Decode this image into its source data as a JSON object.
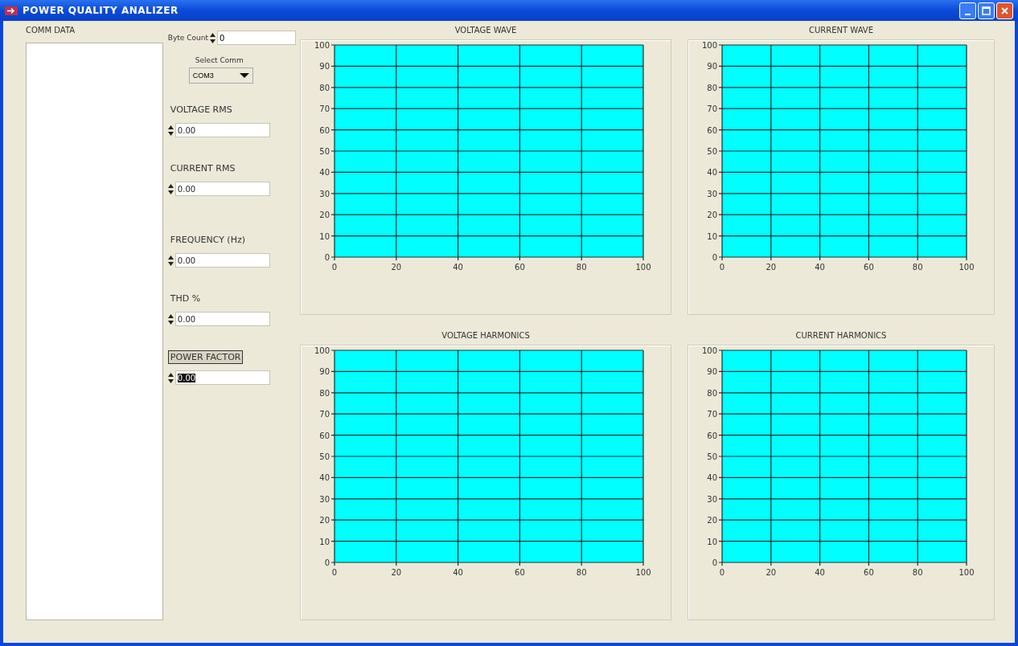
{
  "window": {
    "title": "POWER QUALITY ANALIZER"
  },
  "comm_data": {
    "label": "COMM DATA"
  },
  "byte_count": {
    "label": "Byte Count",
    "value": "0"
  },
  "select_comm": {
    "label": "Select Comm",
    "value": "COM3"
  },
  "readings": [
    {
      "label": "VOLTAGE RMS",
      "value": "0.00",
      "focused": false,
      "text_selected": false
    },
    {
      "label": "CURRENT RMS",
      "value": "0.00",
      "focused": false,
      "text_selected": false
    },
    {
      "label": "FREQUENCY (Hz)",
      "value": "0.00",
      "focused": false,
      "text_selected": false
    },
    {
      "label": "THD %",
      "value": "0.00",
      "focused": false,
      "text_selected": false
    },
    {
      "label": "POWER FACTOR",
      "value": "0.00",
      "focused": true,
      "text_selected": true
    }
  ],
  "charts": [
    {
      "chart_data": {
        "type": "line",
        "grid": true,
        "title": "VOLTAGE WAVE",
        "xlim": [
          0,
          100
        ],
        "ylim": [
          0,
          100
        ],
        "xticks": [
          0,
          20,
          40,
          60,
          80,
          100
        ],
        "yticks": [
          0,
          10,
          20,
          30,
          40,
          50,
          60,
          70,
          80,
          90,
          100
        ]
      }
    },
    {
      "chart_data": {
        "type": "line",
        "grid": true,
        "title": "CURRENT WAVE",
        "xlim": [
          0,
          100
        ],
        "ylim": [
          0,
          100
        ],
        "xticks": [
          0,
          20,
          40,
          60,
          80,
          100
        ],
        "yticks": [
          0,
          10,
          20,
          30,
          40,
          50,
          60,
          70,
          80,
          90,
          100
        ]
      }
    },
    {
      "chart_data": {
        "type": "line",
        "grid": true,
        "title": "VOLTAGE HARMONICS",
        "xlim": [
          0,
          100
        ],
        "ylim": [
          0,
          100
        ],
        "xticks": [
          0,
          20,
          40,
          60,
          80,
          100
        ],
        "yticks": [
          0,
          10,
          20,
          30,
          40,
          50,
          60,
          70,
          80,
          90,
          100
        ]
      }
    },
    {
      "chart_data": {
        "type": "line",
        "grid": true,
        "title": "CURRENT HARMONICS",
        "xlim": [
          0,
          100
        ],
        "ylim": [
          0,
          100
        ],
        "xticks": [
          0,
          20,
          40,
          60,
          80,
          100
        ],
        "yticks": [
          0,
          10,
          20,
          30,
          40,
          50,
          60,
          70,
          80,
          90,
          100
        ]
      }
    }
  ]
}
